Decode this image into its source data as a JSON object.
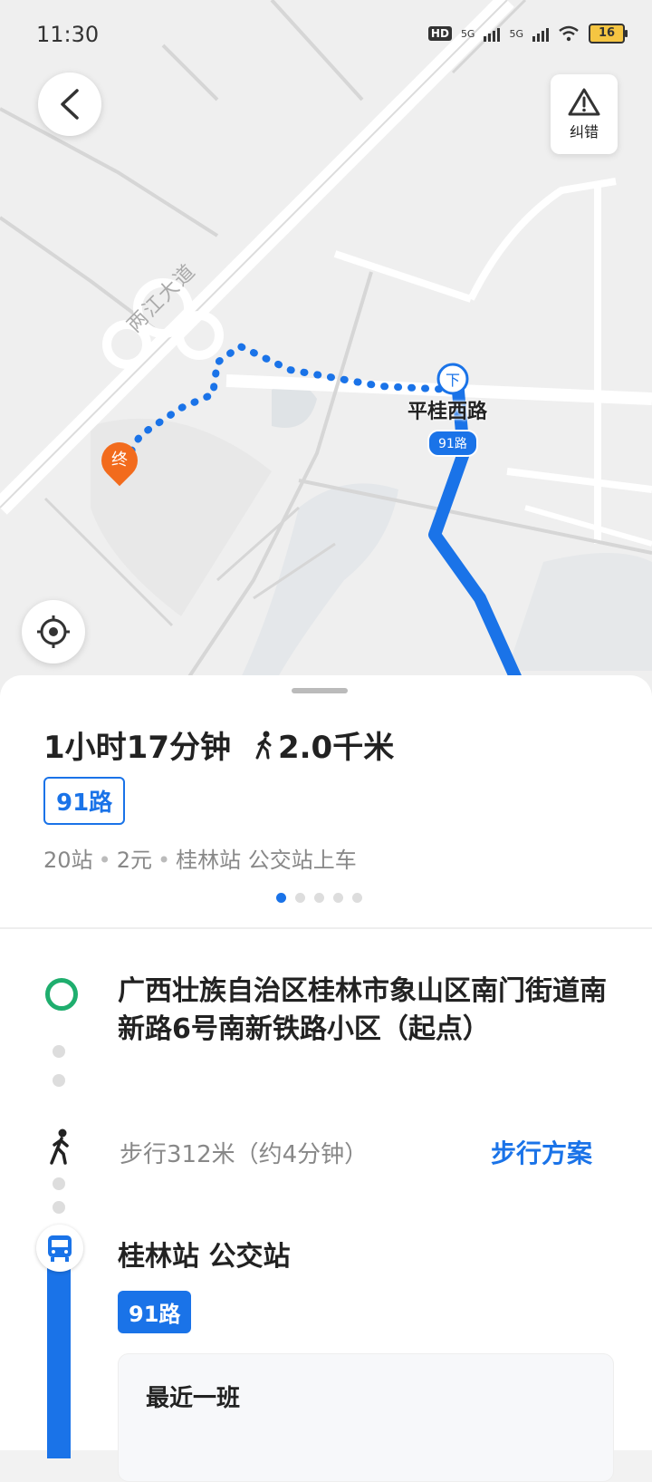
{
  "status_bar": {
    "time": "11:30",
    "network_1": "5G",
    "network_2": "5G",
    "hd": "HD",
    "battery": "16"
  },
  "map": {
    "report_label": "纠错",
    "road_label": "两江大道",
    "stop_name": "平桂西路",
    "route_badge": "91路",
    "alight_marker": "下",
    "end_marker": "终"
  },
  "summary": {
    "duration": "1小时17分钟",
    "walk_distance": "2.0千米",
    "route_chip": "91路",
    "stops": "20站",
    "price": "2元",
    "board_info": "桂林站 公交站上车",
    "pager_count": 5,
    "pager_active": 0
  },
  "steps": {
    "start_address": "广西壮族自治区桂林市象山区南门街道南新路6号南新铁路小区（起点）",
    "walk_text": "步行312米（约4分钟）",
    "walk_plan_label": "步行方案",
    "bus_stop": "桂林站 公交站",
    "bus_route": "91路",
    "next_bus_label": "最近一班"
  },
  "colors": {
    "accent": "#1a73e8",
    "start": "#1fae6e",
    "end_marker": "#f26b1d"
  }
}
